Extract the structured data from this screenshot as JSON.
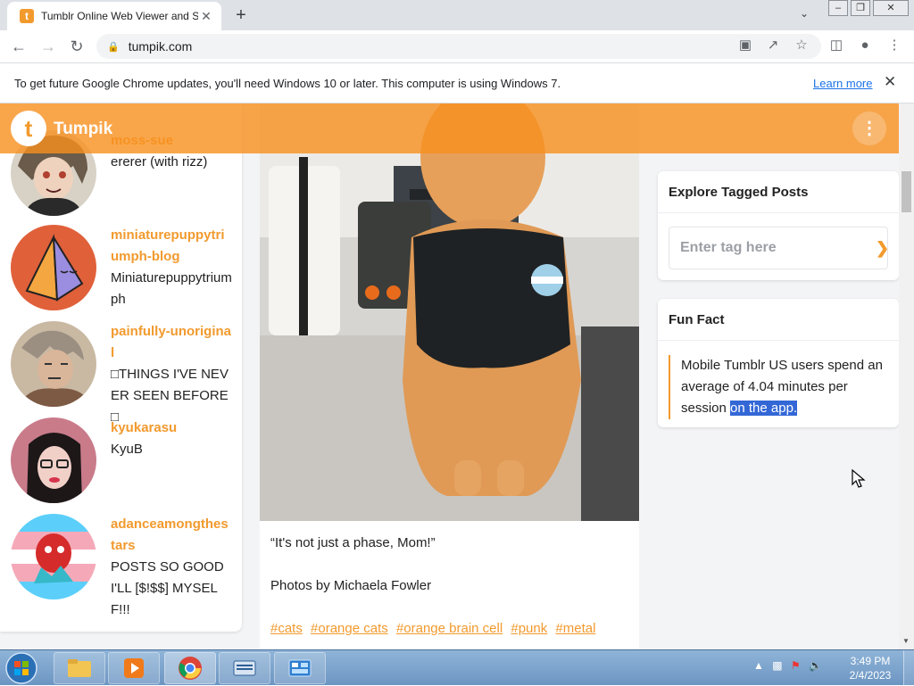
{
  "browser": {
    "tab_title": "Tumblr Online Web Viewer and S",
    "url": "tumpik.com",
    "infobar_message": "To get future Google Chrome updates, you'll need Windows 10 or later. This computer is using Windows 7.",
    "infobar_link": "Learn more"
  },
  "site": {
    "brand": "Tumpik",
    "logo_letter": "t",
    "accent_color": "#f29a2e"
  },
  "blogs": [
    {
      "name": "moss-sue",
      "desc": "ererer (with rizz)"
    },
    {
      "name": "miniaturepuppytriumph-blog",
      "desc": "Miniaturepuppytriumph"
    },
    {
      "name": "painfully-unoriginal",
      "desc": "□THINGS I'VE NEVER SEEN BEFORE□"
    },
    {
      "name": "kyukarasu",
      "desc": "KyuB"
    },
    {
      "name": "adanceamongthestars",
      "desc": "POSTS SO GOOD I'LL [$!$$] MYSELF!!!"
    }
  ],
  "post": {
    "caption1": "“It's not just a phase, Mom!”",
    "caption2": "Photos by Michaela Fowler",
    "tags": [
      "#cats",
      "#orange cats",
      "#orange brain cell",
      "#punk",
      "#metal"
    ]
  },
  "explore": {
    "title": "Explore Tagged Posts",
    "placeholder": "Enter tag here"
  },
  "funfact": {
    "title": "Fun Fact",
    "text_before": "Mobile Tumblr US users spend an average of 4.04 minutes per session ",
    "text_selected": "on the app."
  },
  "taskbar": {
    "time": "3:49 PM",
    "date": "2/4/2023"
  }
}
